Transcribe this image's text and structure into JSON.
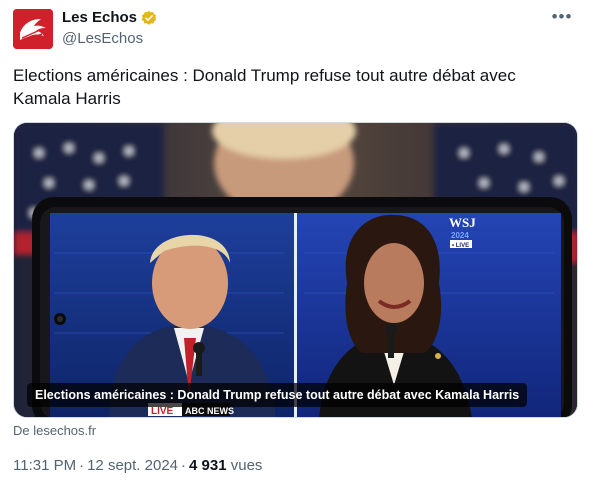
{
  "author": {
    "name": "Les Echos",
    "handle": "@LesEchos",
    "verified": true,
    "brand_color": "#d0202b",
    "verified_color": "#e2b719"
  },
  "tweet": {
    "text": "Elections américaines : Donald Trump refuse tout autre débat avec Kamala Harris",
    "media": {
      "caption": "Elections américaines : Donald Trump refuse tout autre débat avec Kamala Harris",
      "badge": "WSJ",
      "badge_year": "2024",
      "badge_live": "• LIVE",
      "bottom_tags": [
        "LIVE",
        "ABC NEWS"
      ]
    },
    "source": "De lesechos.fr"
  },
  "meta": {
    "time": "11:31 PM",
    "dot": "·",
    "date": "12 sept. 2024",
    "views_count": "4 931",
    "views_label": "vues"
  },
  "icons": {
    "more": "more-horizontal-icon",
    "verified": "verified-badge-icon"
  }
}
